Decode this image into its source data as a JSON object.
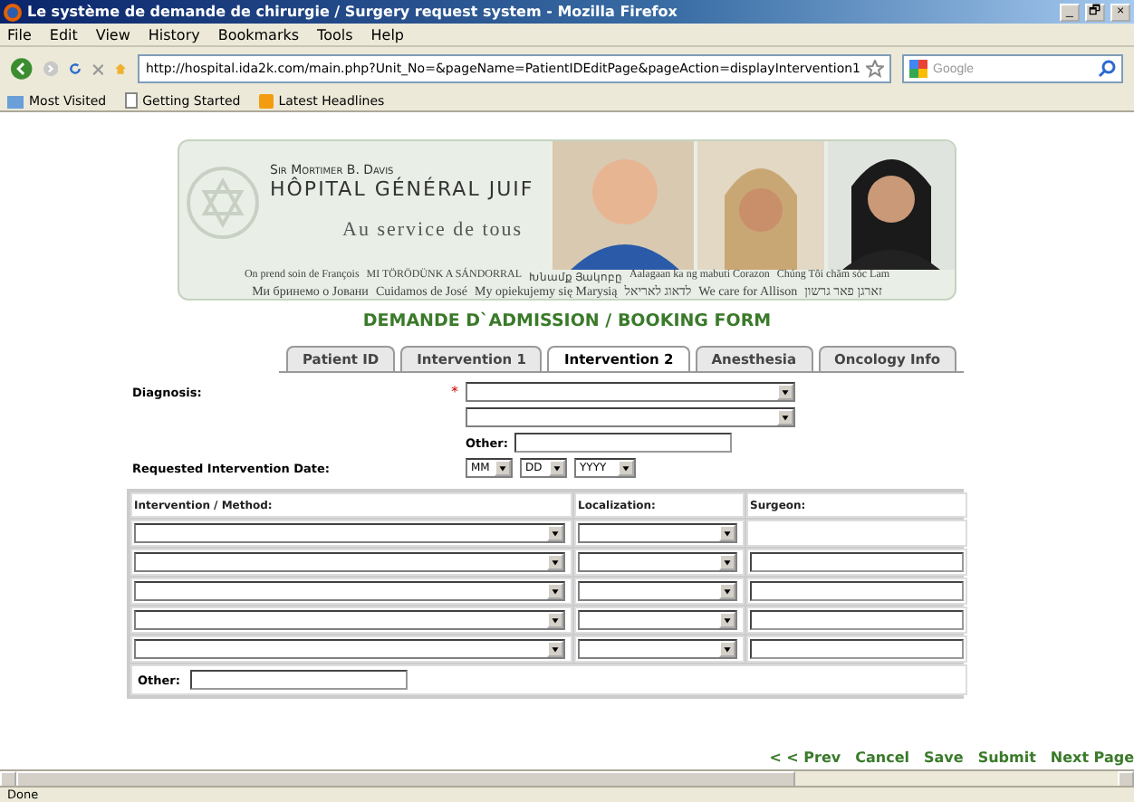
{
  "window": {
    "title": "Le système de demande de chirurgie / Surgery request system - Mozilla Firefox",
    "controls": [
      "_",
      "🗗",
      "×"
    ]
  },
  "menu": [
    "File",
    "Edit",
    "View",
    "History",
    "Bookmarks",
    "Tools",
    "Help"
  ],
  "address": {
    "url": "http://hospital.ida2k.com/main.php?Unit_No=&pageName=PatientIDEditPage&pageAction=displayIntervention1"
  },
  "search": {
    "placeholder": "Google"
  },
  "bookmarks": [
    {
      "label": "Most Visited",
      "kind": "folder"
    },
    {
      "label": "Getting Started",
      "kind": "page"
    },
    {
      "label": "Latest Headlines",
      "kind": "feed"
    }
  ],
  "banner": {
    "small": "Sir Mortimer B. Davis",
    "name": "HÔPITAL GÉNÉRAL JUIF",
    "slogan": "Au service de tous",
    "line_1": [
      "On prend soin de François",
      "MI TÖRÖDÜNK A SÁNDORRAL",
      "Խնամք Յակոբը",
      "Aalagaan ka ng mabuti Corazon",
      "Chúng Tôi chăm sóc Lam"
    ],
    "line_2": [
      "Ми бринемо о Јовани",
      "Cuidamos de José",
      "My opiekujemy się Marysią",
      "לדאוג לאריאל",
      "We care for Allison",
      "זארגן פאר גרשון"
    ]
  },
  "form_title": "DEMANDE D`ADMISSION / BOOKING FORM",
  "tabs": [
    {
      "label": "Patient ID",
      "selected": false
    },
    {
      "label": "Intervention 1",
      "selected": false
    },
    {
      "label": "Intervention 2",
      "selected": true
    },
    {
      "label": "Anesthesia",
      "selected": false
    },
    {
      "label": "Oncology Info",
      "selected": false
    }
  ],
  "diagnosis": {
    "label": "Diagnosis:",
    "required_mark": "*",
    "other_label": "Other:"
  },
  "date": {
    "label": "Requested Intervention Date:",
    "selects": [
      "MM",
      "DD",
      "YYYY"
    ]
  },
  "table": {
    "columns": [
      "Intervention / Method:",
      "Localization:",
      "Surgeon:"
    ],
    "rows": [
      {
        "kind": "no-surgeon"
      },
      {
        "kind": "surgeon"
      },
      {
        "kind": "surgeon"
      },
      {
        "kind": "surgeon"
      },
      {
        "kind": "surgeon"
      }
    ],
    "other_label": "Other:"
  },
  "nav_links": [
    "< < Prev",
    "Cancel",
    "Save",
    "Submit",
    "Next Page"
  ],
  "status_bar": "Done"
}
